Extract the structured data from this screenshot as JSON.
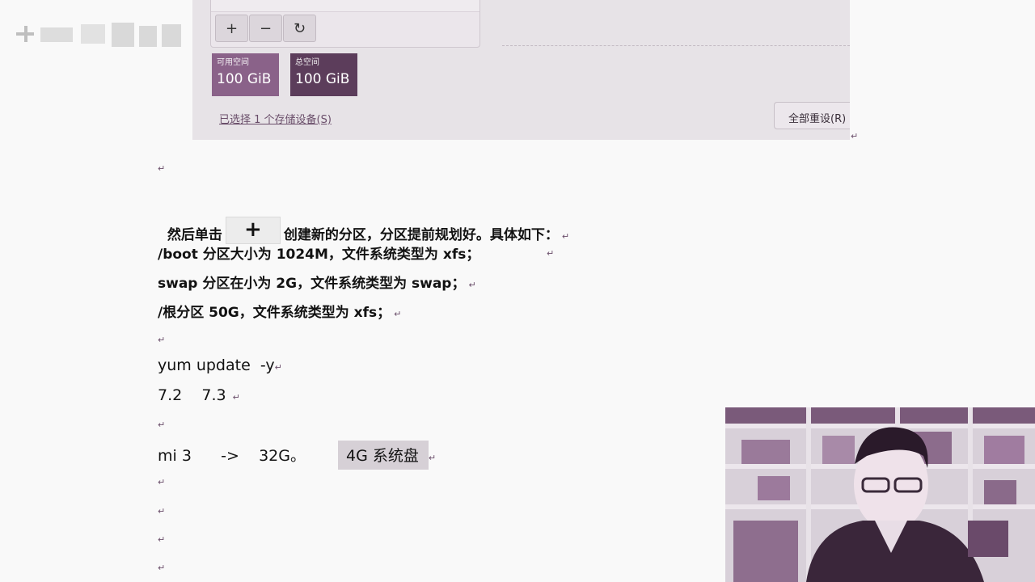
{
  "installer": {
    "toolbar": {
      "add_icon": "plus-icon",
      "remove_icon": "minus-icon",
      "refresh_icon": "refresh-icon"
    },
    "available": {
      "label": "可用空间",
      "value": "100 GiB",
      "color": "#8a6289"
    },
    "total": {
      "label": "总空间",
      "value": "100 GiB",
      "color": "#5c3d5b"
    },
    "selected_link": "已选择 1 个存储设备(S)",
    "reset_button": "全部重设(R)"
  },
  "document": {
    "line1_before": "然后单击",
    "line1_after": "创建新的分区，分区提前规划好。具体如下：",
    "boot_line": "/boot 分区大小为 1024M，文件系统类型为 xfs；",
    "swap_line": "swap 分区在小为 2G，文件系统类型为 swap；",
    "root_line": "/根分区 50G，文件系统类型为 xfs；",
    "yum_line": "yum update  -y",
    "version_line": "7.2    7.3",
    "mi_line": "mi 3      ->    32G。",
    "highlight": "4G 系统盘",
    "paragraph_mark": "↵"
  }
}
